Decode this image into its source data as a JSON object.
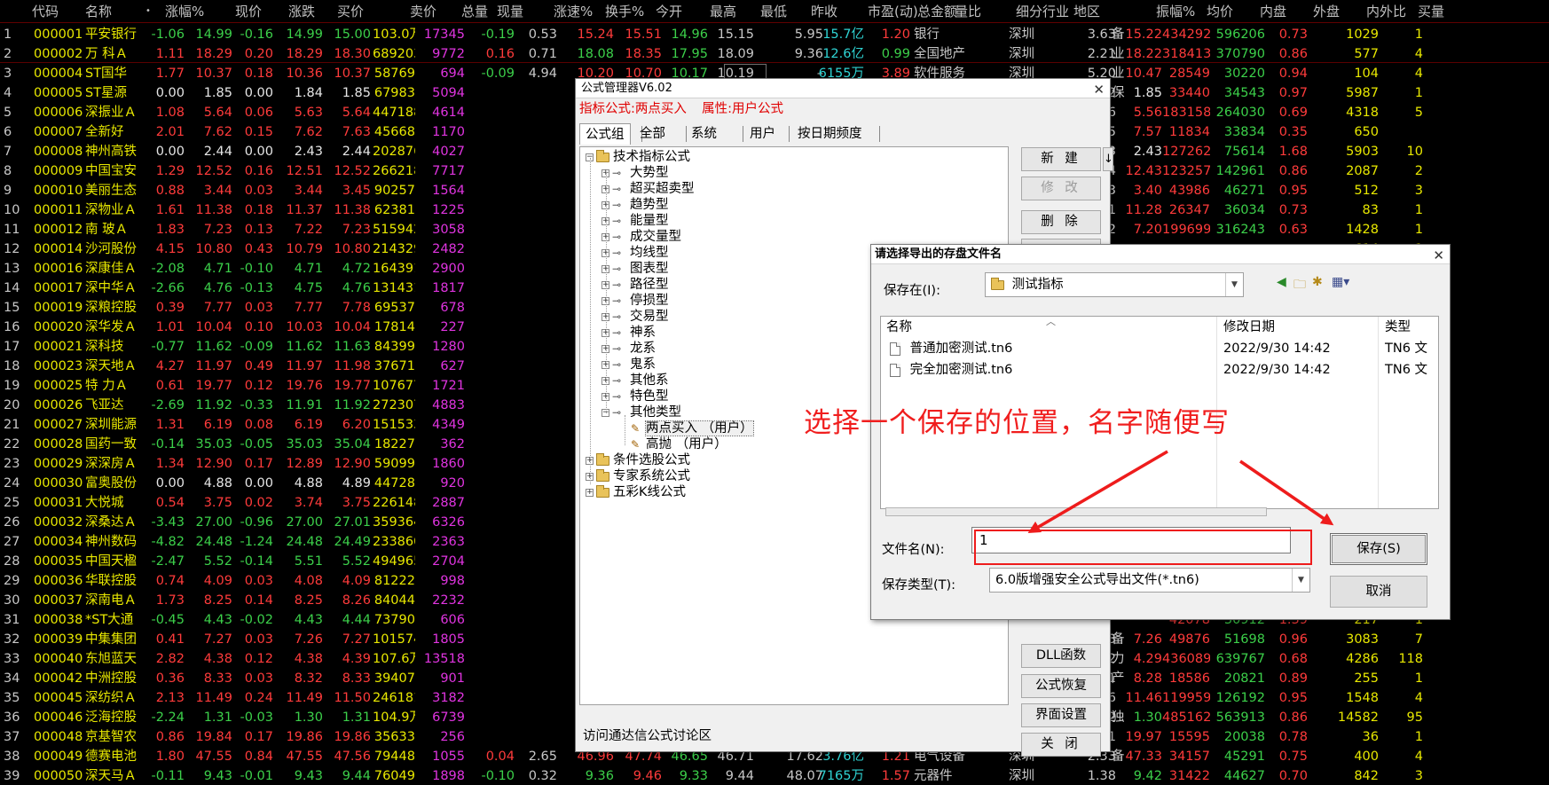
{
  "columns": [
    "代码",
    "名称",
    "•",
    "涨幅%",
    "现价",
    "涨跌",
    "买价",
    "卖价",
    "总量",
    "现量",
    "涨速%",
    "换手%",
    "今开",
    "最高",
    "最低",
    "昨收",
    "市盈(动)",
    "总金额",
    "量比",
    "细分行业",
    "地区",
    "振幅%",
    "均价",
    "内盘",
    "外盘",
    "内外比",
    "买量"
  ],
  "stocks": [
    [
      "1",
      "000001",
      "平安银行",
      "-1.06",
      "14.99",
      "-0.16",
      "14.99",
      "15.00",
      "103.0万",
      "17345",
      "-0.19",
      "0.53",
      "15.24",
      "15.51",
      "14.96",
      "15.15",
      "5.95",
      "15.7亿",
      "1.20",
      "银行",
      "深圳",
      "3.63",
      "15.22",
      "434292",
      "596206",
      "0.73",
      "1029",
      "1"
    ],
    [
      "2",
      "000002",
      "万 科Ａ",
      "1.11",
      "18.29",
      "0.20",
      "18.29",
      "18.30",
      "689203",
      "9772",
      "0.16",
      "0.71",
      "18.08",
      "18.35",
      "17.95",
      "18.09",
      "9.36",
      "12.6亿",
      "0.99",
      "全国地产",
      "深圳",
      "2.21",
      "18.22",
      "318413",
      "370790",
      "0.86",
      "577",
      "4"
    ],
    [
      "3",
      "000004",
      "ST国华",
      "1.77",
      "10.37",
      "0.18",
      "10.36",
      "10.37",
      "58769",
      "694",
      "-0.09",
      "4.94",
      "10.20",
      "10.70",
      "10.17",
      "10.19",
      "–",
      "6155万",
      "3.89",
      "软件服务",
      "深圳",
      "5.20",
      "10.47",
      "28549",
      "30220",
      "0.94",
      "104",
      "4"
    ],
    [
      "4",
      "000005",
      "ST星源",
      "0.00",
      "1.85",
      "0.00",
      "1.84",
      "1.85",
      "67983",
      "5094",
      "",
      "",
      "",
      "",
      "",
      "",
      "",
      "",
      "",
      "",
      "深圳",
      "1.62",
      "1.85",
      "33440",
      "34543",
      "0.97",
      "5987",
      "1"
    ],
    [
      "5",
      "000006",
      "深振业Ａ",
      "1.08",
      "5.64",
      "0.06",
      "5.63",
      "5.64",
      "447188",
      "4614",
      "",
      "",
      "",
      "",
      "",
      "",
      "",
      "",
      "",
      "",
      "深圳",
      "3.76",
      "5.56",
      "183158",
      "264030",
      "0.69",
      "4318",
      "5"
    ],
    [
      "6",
      "000007",
      "全新好",
      "2.01",
      "7.62",
      "0.15",
      "7.62",
      "7.63",
      "45668",
      "1170",
      "",
      "",
      "",
      "",
      "",
      "",
      "",
      "",
      "",
      "",
      "深圳",
      "2.95",
      "7.57",
      "11834",
      "33834",
      "0.35",
      "650",
      ""
    ],
    [
      "7",
      "000008",
      "神州高铁",
      "0.00",
      "2.44",
      "0.00",
      "2.43",
      "2.44",
      "202876",
      "4027",
      "",
      "",
      "",
      "",
      "",
      "",
      "",
      "",
      "",
      "",
      "北京",
      "1.23",
      "2.43",
      "127262",
      "75614",
      "1.68",
      "5903",
      "10"
    ],
    [
      "8",
      "000009",
      "中国宝安",
      "1.29",
      "12.52",
      "0.16",
      "12.51",
      "12.52",
      "266218",
      "7717",
      "",
      "",
      "",
      "",
      "",
      "",
      "",
      "",
      "",
      "",
      "深圳",
      "1.94",
      "12.43",
      "123257",
      "142961",
      "0.86",
      "2087",
      "2"
    ],
    [
      "9",
      "000010",
      "美丽生态",
      "0.88",
      "3.44",
      "0.03",
      "3.44",
      "3.45",
      "90257",
      "1564",
      "",
      "",
      "",
      "",
      "",
      "",
      "",
      "",
      "",
      "",
      "深圳",
      "2.93",
      "3.40",
      "43986",
      "46271",
      "0.95",
      "512",
      "3"
    ],
    [
      "10",
      "000011",
      "深物业Ａ",
      "1.61",
      "11.38",
      "0.18",
      "11.37",
      "11.38",
      "62381",
      "1225",
      "",
      "",
      "",
      "",
      "",
      "",
      "",
      "",
      "",
      "",
      "深圳",
      "3.21",
      "11.28",
      "26347",
      "36034",
      "0.73",
      "83",
      "1"
    ],
    [
      "11",
      "000012",
      "南 玻Ａ",
      "1.83",
      "7.23",
      "0.13",
      "7.22",
      "7.23",
      "515942",
      "3058",
      "",
      "",
      "",
      "",
      "",
      "",
      "",
      "",
      "",
      "",
      "深圳",
      "3.52",
      "7.20",
      "199699",
      "316243",
      "0.63",
      "1428",
      "1"
    ],
    [
      "12",
      "000014",
      "沙河股份",
      "4.15",
      "10.80",
      "0.43",
      "10.79",
      "10.80",
      "214329",
      "2482",
      "",
      "",
      "",
      "",
      "",
      "",
      "",
      "",
      "",
      "",
      "",
      "",
      "",
      "",
      "",
      "",
      "614",
      "1"
    ],
    [
      "13",
      "000016",
      "深康佳Ａ",
      "-2.08",
      "4.71",
      "-0.10",
      "4.71",
      "4.72",
      "164391",
      "2900",
      "",
      "",
      "",
      "",
      "",
      "",
      "",
      "",
      "",
      "",
      "",
      "",
      "",
      "",
      "",
      "",
      "389",
      "8"
    ],
    [
      "14",
      "000017",
      "深中华Ａ",
      "-2.66",
      "4.76",
      "-0.13",
      "4.75",
      "4.76",
      "131431",
      "1817",
      "",
      "",
      "",
      "",
      "",
      "",
      "",
      "",
      "",
      "",
      "",
      "",
      "",
      "",
      "",
      "",
      "1852",
      "8"
    ],
    [
      "15",
      "000019",
      "深粮控股",
      "0.39",
      "7.77",
      "0.03",
      "7.77",
      "7.78",
      "69537",
      "678",
      "",
      "",
      "",
      "",
      "",
      "",
      "",
      "",
      "",
      "",
      "",
      "",
      "",
      "",
      "",
      "",
      "43",
      "7"
    ],
    [
      "16",
      "000020",
      "深华发Ａ",
      "1.01",
      "10.04",
      "0.10",
      "10.03",
      "10.04",
      "17814",
      "227",
      "",
      "",
      "",
      "",
      "",
      "",
      "",
      "",
      "",
      "",
      "",
      "",
      "",
      "",
      "",
      "",
      "40",
      "1"
    ],
    [
      "17",
      "000021",
      "深科技",
      "-0.77",
      "11.62",
      "-0.09",
      "11.62",
      "11.63",
      "84399",
      "1280",
      "",
      "",
      "",
      "",
      "",
      "",
      "",
      "",
      "",
      "",
      "",
      "",
      "",
      "",
      "",
      "",
      "96",
      "3"
    ],
    [
      "18",
      "000023",
      "深天地Ａ",
      "4.27",
      "11.97",
      "0.49",
      "11.97",
      "11.98",
      "37671",
      "627",
      "",
      "",
      "",
      "",
      "",
      "",
      "",
      "",
      "",
      "",
      "",
      "",
      "",
      "",
      "",
      "",
      "121",
      "4"
    ],
    [
      "19",
      "000025",
      "特 力Ａ",
      "0.61",
      "19.77",
      "0.12",
      "19.76",
      "19.77",
      "107677",
      "1721",
      "",
      "",
      "",
      "",
      "",
      "",
      "",
      "",
      "",
      "",
      "",
      "",
      "",
      "",
      "",
      "",
      "768",
      "6"
    ],
    [
      "20",
      "000026",
      "飞亚达",
      "-2.69",
      "11.92",
      "-0.33",
      "11.91",
      "11.92",
      "272307",
      "4883",
      "",
      "",
      "",
      "",
      "",
      "",
      "",
      "",
      "",
      "",
      "",
      "",
      "",
      "",
      "",
      "",
      "618",
      "3"
    ],
    [
      "21",
      "000027",
      "深圳能源",
      "1.31",
      "6.19",
      "0.08",
      "6.19",
      "6.20",
      "151533",
      "4349",
      "",
      "",
      "",
      "",
      "",
      "",
      "",
      "",
      "",
      "",
      "",
      "",
      "",
      "",
      "",
      "",
      "47",
      "77"
    ],
    [
      "22",
      "000028",
      "国药一致",
      "-0.14",
      "35.03",
      "-0.05",
      "35.03",
      "35.04",
      "18227",
      "362",
      "",
      "",
      "",
      "",
      "",
      "",
      "",
      "",
      "",
      "",
      "",
      "",
      "",
      "",
      "",
      "",
      "31",
      "3"
    ],
    [
      "23",
      "000029",
      "深深房Ａ",
      "1.34",
      "12.90",
      "0.17",
      "12.89",
      "12.90",
      "59099",
      "1860",
      "",
      "",
      "",
      "",
      "",
      "",
      "",
      "",
      "",
      "",
      "",
      "",
      "",
      "",
      "",
      "",
      "82",
      "1"
    ],
    [
      "24",
      "000030",
      "富奥股份",
      "0.00",
      "4.88",
      "0.00",
      "4.88",
      "4.89",
      "44728",
      "920",
      "",
      "",
      "",
      "",
      "",
      "",
      "",
      "",
      "",
      "",
      "",
      "",
      "",
      "",
      "",
      "",
      "601",
      "2"
    ],
    [
      "25",
      "000031",
      "大悦城",
      "0.54",
      "3.75",
      "0.02",
      "3.74",
      "3.75",
      "226148",
      "2887",
      "",
      "",
      "",
      "",
      "",
      "",
      "",
      "",
      "",
      "",
      "",
      "",
      "",
      "",
      "",
      "",
      "1639",
      "40"
    ],
    [
      "26",
      "000032",
      "深桑达Ａ",
      "-3.43",
      "27.00",
      "-0.96",
      "27.00",
      "27.01",
      "359364",
      "6326",
      "",
      "",
      "",
      "",
      "",
      "",
      "",
      "",
      "",
      "",
      "",
      "",
      "",
      "",
      "",
      "",
      "214",
      "3"
    ],
    [
      "27",
      "000034",
      "神州数码",
      "-4.82",
      "24.48",
      "-1.24",
      "24.48",
      "24.49",
      "233860",
      "2363",
      "",
      "",
      "",
      "",
      "",
      "",
      "",
      "",
      "",
      "",
      "",
      "",
      "",
      "",
      "",
      "",
      "269",
      "2"
    ],
    [
      "28",
      "000035",
      "中国天楹",
      "-2.47",
      "5.52",
      "-0.14",
      "5.51",
      "5.52",
      "494965",
      "2704",
      "",
      "",
      "",
      "",
      "",
      "",
      "",
      "",
      "",
      "",
      "",
      "",
      "",
      "",
      "",
      "",
      "2046",
      "3"
    ],
    [
      "29",
      "000036",
      "华联控股",
      "0.74",
      "4.09",
      "0.03",
      "4.08",
      "4.09",
      "81222",
      "998",
      "",
      "",
      "",
      "",
      "",
      "",
      "",
      "",
      "",
      "",
      "",
      "",
      "",
      "",
      "",
      "",
      "2624",
      "20"
    ],
    [
      "30",
      "000037",
      "深南电Ａ",
      "1.73",
      "8.25",
      "0.14",
      "8.25",
      "8.26",
      "84044",
      "2232",
      "",
      "",
      "",
      "",
      "",
      "",
      "",
      "",
      "",
      "",
      "",
      "",
      "",
      "",
      "",
      "",
      "947",
      "1"
    ],
    [
      "31",
      "000038",
      "*ST大通",
      "-0.45",
      "4.43",
      "-0.02",
      "4.43",
      "4.44",
      "73790",
      "606",
      "",
      "",
      "",
      "",
      "",
      "",
      "",
      "",
      "",
      "",
      "",
      "",
      "",
      "42078",
      "30912",
      "1.39",
      "217",
      "1"
    ],
    [
      "32",
      "000039",
      "中集集团",
      "0.41",
      "7.27",
      "0.03",
      "7.26",
      "7.27",
      "101574",
      "1805",
      "",
      "",
      "",
      "",
      "",
      "",
      "",
      "",
      "",
      "",
      "深圳",
      "0.83",
      "7.26",
      "49876",
      "51698",
      "0.96",
      "3083",
      "7"
    ],
    [
      "33",
      "000040",
      "东旭蓝天",
      "2.82",
      "4.38",
      "0.12",
      "4.38",
      "4.39",
      "107.6万",
      "13518",
      "",
      "",
      "",
      "",
      "",
      "",
      "",
      "",
      "",
      "",
      "深圳",
      "8.22",
      "4.29",
      "436089",
      "639767",
      "0.68",
      "4286",
      "118"
    ],
    [
      "34",
      "000042",
      "中洲控股",
      "0.36",
      "8.33",
      "0.03",
      "8.32",
      "8.33",
      "39407",
      "901",
      "",
      "",
      "",
      "",
      "",
      "",
      "",
      "",
      "",
      "",
      "深圳",
      "1.81",
      "8.28",
      "18586",
      "20821",
      "0.89",
      "255",
      "1"
    ],
    [
      "35",
      "000045",
      "深纺织Ａ",
      "2.13",
      "11.49",
      "0.24",
      "11.49",
      "11.50",
      "246181",
      "3182",
      "",
      "",
      "",
      "",
      "",
      "",
      "",
      "",
      "",
      "",
      "深圳",
      "8.36",
      "11.46",
      "119959",
      "126192",
      "0.95",
      "1548",
      "4"
    ],
    [
      "36",
      "000046",
      "泛海控股",
      "-2.24",
      "1.31",
      "-0.03",
      "1.30",
      "1.31",
      "104.9万",
      "6739",
      "",
      "",
      "",
      "",
      "",
      "",
      "",
      "",
      "",
      "",
      "北京",
      "5.22",
      "1.30",
      "485162",
      "563913",
      "0.86",
      "14582",
      "95"
    ],
    [
      "37",
      "000048",
      "京基智农",
      "0.86",
      "19.84",
      "0.17",
      "19.86",
      "19.86",
      "35633",
      "256",
      "",
      "",
      "",
      "",
      "",
      "",
      "",
      "",
      "",
      "",
      "深圳",
      "3.61",
      "19.97",
      "15595",
      "20038",
      "0.78",
      "36",
      "1"
    ],
    [
      "38",
      "000049",
      "德赛电池",
      "1.80",
      "47.55",
      "0.84",
      "47.55",
      "47.56",
      "79448",
      "1055",
      "0.04",
      "2.65",
      "46.96",
      "47.74",
      "46.65",
      "46.71",
      "17.62",
      "3.76亿",
      "1.21",
      "电气设备",
      "深圳",
      "2.33",
      "47.33",
      "34157",
      "45291",
      "0.75",
      "400",
      "4"
    ],
    [
      "39",
      "000050",
      "深天马Ａ",
      "-0.11",
      "9.43",
      "-0.01",
      "9.43",
      "9.44",
      "76049",
      "1898",
      "-0.10",
      "0.32",
      "9.36",
      "9.46",
      "9.33",
      "9.44",
      "48.07",
      "7165万",
      "1.57",
      "元器件",
      "深圳",
      "1.38",
      "9.42",
      "31422",
      "44627",
      "0.70",
      "842",
      "3"
    ]
  ],
  "right_edge_glimpses": [
    "备",
    "业",
    "业",
    "保",
    "",
    "",
    "",
    "",
    "",
    "",
    "",
    "",
    "",
    "",
    "",
    "",
    "",
    "",
    "",
    "",
    "",
    "",
    "",
    "",
    "",
    "",
    "",
    "",
    "",
    "",
    "",
    "备",
    "力",
    "产",
    "",
    "独",
    "",
    "备",
    ""
  ],
  "formula_manager": {
    "title": "公式管理器V6.02",
    "info_prefix": "指标公式:两点买入",
    "info_attr": "属性:用户公式",
    "tabs": [
      "公式组",
      "全部",
      "系统",
      "用户",
      "按日期频度"
    ],
    "tree": [
      {
        "label": "技术指标公式",
        "level": 0,
        "kind": "folder",
        "expander": "−"
      },
      {
        "label": "大势型",
        "level": 1,
        "kind": "key",
        "expander": "+"
      },
      {
        "label": "超买超卖型",
        "level": 1,
        "kind": "key",
        "expander": "+"
      },
      {
        "label": "趋势型",
        "level": 1,
        "kind": "key",
        "expander": "+"
      },
      {
        "label": "能量型",
        "level": 1,
        "kind": "key",
        "expander": "+"
      },
      {
        "label": "成交量型",
        "level": 1,
        "kind": "key",
        "expander": "+"
      },
      {
        "label": "均线型",
        "level": 1,
        "kind": "key",
        "expander": "+"
      },
      {
        "label": "图表型",
        "level": 1,
        "kind": "key",
        "expander": "+"
      },
      {
        "label": "路径型",
        "level": 1,
        "kind": "key",
        "expander": "+"
      },
      {
        "label": "停损型",
        "level": 1,
        "kind": "key",
        "expander": "+"
      },
      {
        "label": "交易型",
        "level": 1,
        "kind": "key",
        "expander": "+"
      },
      {
        "label": "神系",
        "level": 1,
        "kind": "key",
        "expander": "+"
      },
      {
        "label": "龙系",
        "level": 1,
        "kind": "key",
        "expander": "+"
      },
      {
        "label": "鬼系",
        "level": 1,
        "kind": "key",
        "expander": "+"
      },
      {
        "label": "其他系",
        "level": 1,
        "kind": "key",
        "expander": "+"
      },
      {
        "label": "特色型",
        "level": 1,
        "kind": "key",
        "expander": "+"
      },
      {
        "label": "其他类型",
        "level": 1,
        "kind": "key",
        "expander": "−"
      },
      {
        "label": "两点买入  （用户）",
        "level": 2,
        "kind": "formula",
        "expander": "",
        "selected": true
      },
      {
        "label": "高抛  （用户）",
        "level": 2,
        "kind": "formula",
        "expander": ""
      },
      {
        "label": "条件选股公式",
        "level": 0,
        "kind": "folder",
        "expander": "+"
      },
      {
        "label": "专家系统公式",
        "level": 0,
        "kind": "folder",
        "expander": "+"
      },
      {
        "label": "五彩K线公式",
        "level": 0,
        "kind": "folder",
        "expander": "+"
      }
    ],
    "buttons": {
      "new": "新 建",
      "modify": "修 改",
      "delete": "删 除",
      "dll": "DLL函数",
      "restore": "公式恢复",
      "ui_settings": "界面设置",
      "close": "关 闭"
    },
    "new_arrow": "↓",
    "forum_link": "访问通达信公式讨论区"
  },
  "save_dialog": {
    "title": "请选择导出的存盘文件名",
    "save_in_label": "保存在(I):",
    "save_in_value": "测试指标",
    "file_list": {
      "headers": {
        "name": "名称",
        "date": "修改日期",
        "type": "类型"
      },
      "files": [
        {
          "name": "普通加密测试.tn6",
          "date": "2022/9/30 14:42",
          "type": "TN6 文"
        },
        {
          "name": "完全加密测试.tn6",
          "date": "2022/9/30 14:42",
          "type": "TN6 文"
        }
      ]
    },
    "filename_label": "文件名(N):",
    "filename_value": "1",
    "filetype_label": "保存类型(T):",
    "filetype_value": "6.0版增强安全公式导出文件(*.tn6)",
    "save_button": "保存(S)",
    "cancel_button": "取消"
  },
  "annotation": {
    "text": "选择一个保存的位置，名字随便写",
    "color": "#f01e1e"
  },
  "colors": {
    "up": "#ff3b3b",
    "down": "#3cd04a",
    "code": "#e8e800",
    "amount": "#2fd4d4",
    "volume_now": "#e034e0"
  }
}
